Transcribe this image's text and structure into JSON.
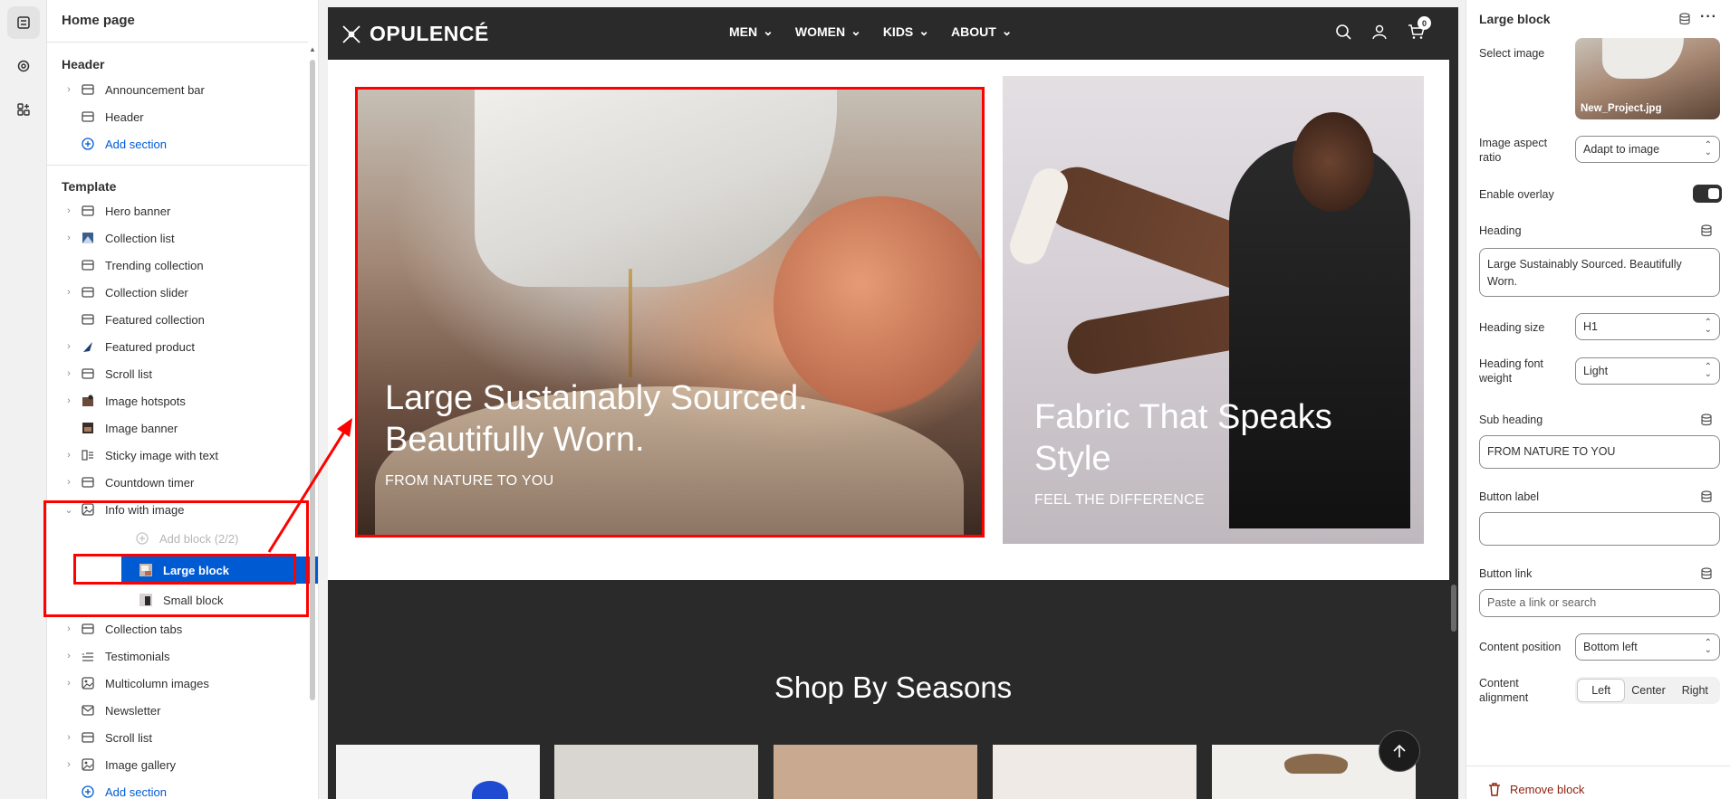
{
  "sidebar": {
    "title": "Home page",
    "header_group": "Header",
    "header_items": [
      "Announcement bar",
      "Header"
    ],
    "add_section": "Add section",
    "template_group": "Template",
    "template_items": [
      "Hero banner",
      "Collection list",
      "Trending collection",
      "Collection slider",
      "Featured collection",
      "Featured product",
      "Scroll list",
      "Image hotspots",
      "Image banner",
      "Sticky image with text",
      "Countdown timer",
      "Info with image"
    ],
    "add_block": "Add block (2/2)",
    "blocks": [
      "Large block",
      "Small block"
    ],
    "after_items": [
      "Collection tabs",
      "Testimonials",
      "Multicolumn images",
      "Newsletter",
      "Scroll list",
      "Image gallery"
    ],
    "add_section_bottom": "Add section"
  },
  "store": {
    "logo": "OPULENCÉ",
    "menu": [
      "MEN",
      "WOMEN",
      "KIDS",
      "ABOUT"
    ],
    "cart_count": "0",
    "large_heading": "Large Sustainably Sourced. Beautifully Worn.",
    "large_sub": "FROM NATURE TO YOU",
    "small_heading": "Fabric That Speaks Style",
    "small_sub": "FEEL THE DIFFERENCE",
    "seasons_title": "Shop By Seasons"
  },
  "panel": {
    "title": "Large block",
    "select_image_label": "Select image",
    "image_file": "New_Project.jpg",
    "aspect_label": "Image aspect ratio",
    "aspect_value": "Adapt to image",
    "overlay_label": "Enable overlay",
    "overlay_on": true,
    "heading_label": "Heading",
    "heading_value": "Large Sustainably Sourced. Beautifully Worn.",
    "heading_size_label": "Heading size",
    "heading_size_value": "H1",
    "heading_weight_label": "Heading font weight",
    "heading_weight_value": "Light",
    "subheading_label": "Sub heading",
    "subheading_value": "FROM NATURE TO YOU",
    "button_label_label": "Button label",
    "button_label_value": "",
    "button_link_label": "Button link",
    "button_link_placeholder": "Paste a link or search",
    "content_position_label": "Content position",
    "content_position_value": "Bottom left",
    "content_alignment_label": "Content alignment",
    "alignment_options": [
      "Left",
      "Center",
      "Right"
    ],
    "alignment_selected": "Left",
    "remove_label": "Remove block"
  },
  "colors": {
    "accent_blue": "#005bd3",
    "annotation_red": "#ff0000",
    "store_dark": "#2a2a2a"
  }
}
